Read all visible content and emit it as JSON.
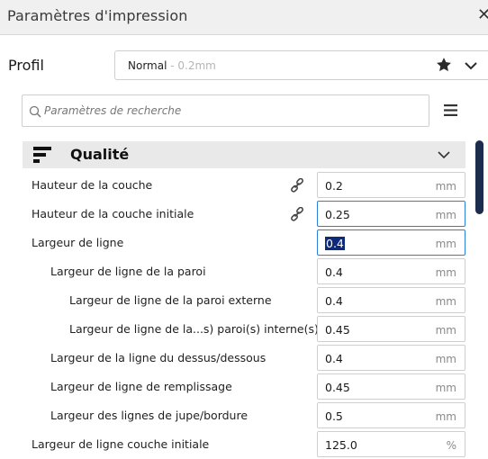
{
  "window": {
    "title": "Paramètres d'impression",
    "close_symbol": "✕"
  },
  "profile": {
    "label": "Profil",
    "name": "Normal",
    "sub": " - 0.2mm"
  },
  "search": {
    "placeholder": "Paramètres de recherche"
  },
  "section": {
    "title": "Qualité"
  },
  "settings": [
    {
      "label": "Hauteur de la couche",
      "value": "0.2",
      "unit": "mm",
      "linked": true
    },
    {
      "label": "Hauteur de la couche initiale",
      "value": "0.25",
      "unit": "mm",
      "linked": true
    },
    {
      "label": "Largeur de ligne",
      "value": "0.4",
      "unit": "mm",
      "selected": true
    },
    {
      "label": "Largeur de ligne de la paroi",
      "value": "0.4",
      "unit": "mm"
    },
    {
      "label": "Largeur de ligne de la paroi externe",
      "value": "0.4",
      "unit": "mm"
    },
    {
      "label": "Largeur de ligne de la...s) paroi(s) interne(s)",
      "value": "0.45",
      "unit": "mm"
    },
    {
      "label": "Largeur de la ligne du dessus/dessous",
      "value": "0.4",
      "unit": "mm"
    },
    {
      "label": "Largeur de ligne de remplissage",
      "value": "0.45",
      "unit": "mm"
    },
    {
      "label": "Largeur des lignes de jupe/bordure",
      "value": "0.5",
      "unit": "mm"
    },
    {
      "label": "Largeur de ligne couche initiale",
      "value": "125.0",
      "unit": "%"
    }
  ]
}
